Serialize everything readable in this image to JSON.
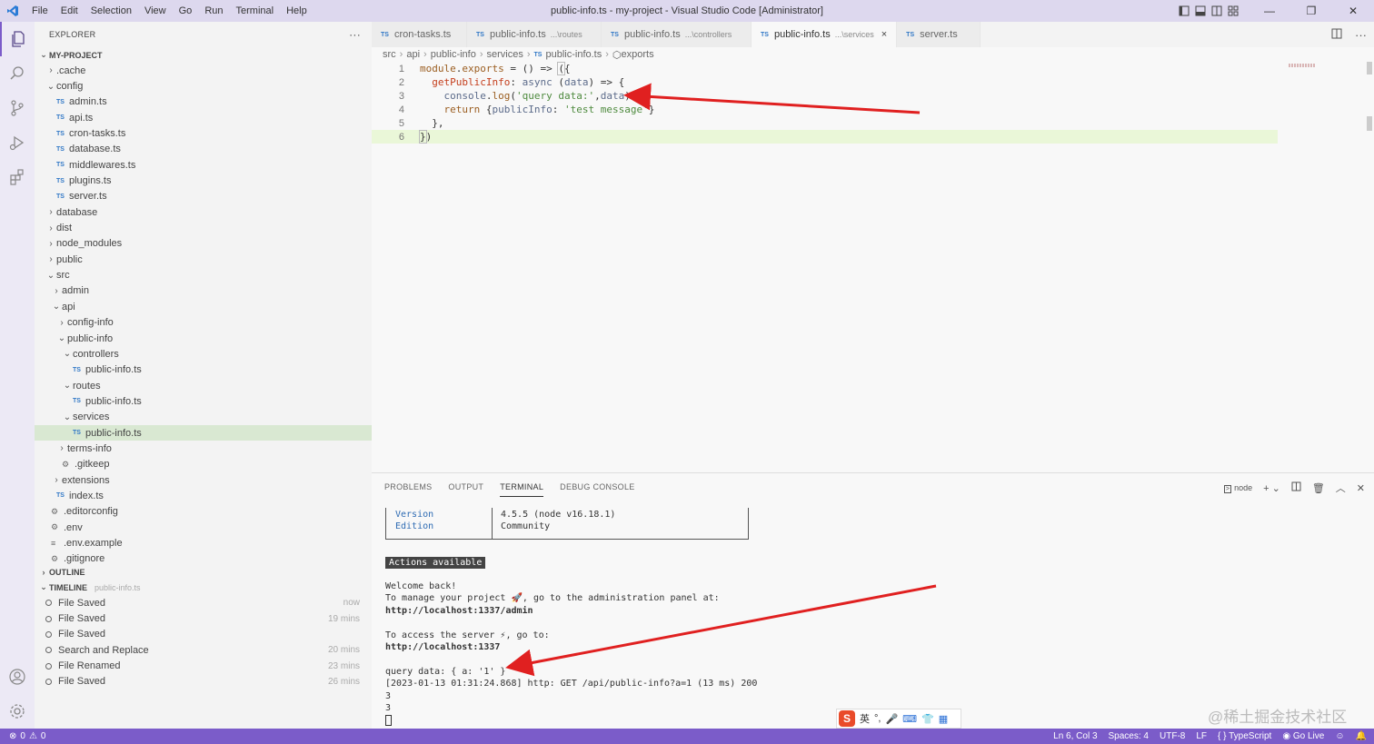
{
  "titlebar": {
    "menu": [
      "File",
      "Edit",
      "Selection",
      "View",
      "Go",
      "Run",
      "Terminal",
      "Help"
    ],
    "window_title": "public-info.ts - my-project - Visual Studio Code [Administrator]"
  },
  "sidebar": {
    "explorer_label": "EXPLORER",
    "more": "···",
    "project": "MY-PROJECT",
    "tree": [
      {
        "label": ".cache",
        "type": "folder",
        "open": false,
        "depth": 0
      },
      {
        "label": "config",
        "type": "folder",
        "open": true,
        "depth": 0
      },
      {
        "label": "admin.ts",
        "type": "ts",
        "depth": 1
      },
      {
        "label": "api.ts",
        "type": "ts",
        "depth": 1
      },
      {
        "label": "cron-tasks.ts",
        "type": "ts",
        "depth": 1
      },
      {
        "label": "database.ts",
        "type": "ts",
        "depth": 1
      },
      {
        "label": "middlewares.ts",
        "type": "ts",
        "depth": 1
      },
      {
        "label": "plugins.ts",
        "type": "ts",
        "depth": 1
      },
      {
        "label": "server.ts",
        "type": "ts",
        "depth": 1
      },
      {
        "label": "database",
        "type": "folder",
        "open": false,
        "depth": 0
      },
      {
        "label": "dist",
        "type": "folder",
        "open": false,
        "depth": 0
      },
      {
        "label": "node_modules",
        "type": "folder",
        "open": false,
        "depth": 0
      },
      {
        "label": "public",
        "type": "folder",
        "open": false,
        "depth": 0
      },
      {
        "label": "src",
        "type": "folder",
        "open": true,
        "depth": 0
      },
      {
        "label": "admin",
        "type": "folder",
        "open": false,
        "depth": 1
      },
      {
        "label": "api",
        "type": "folder",
        "open": true,
        "depth": 1
      },
      {
        "label": "config-info",
        "type": "folder",
        "open": false,
        "depth": 2
      },
      {
        "label": "public-info",
        "type": "folder",
        "open": true,
        "depth": 2
      },
      {
        "label": "controllers",
        "type": "folder",
        "open": true,
        "depth": 3
      },
      {
        "label": "public-info.ts",
        "type": "ts",
        "depth": 4
      },
      {
        "label": "routes",
        "type": "folder",
        "open": true,
        "depth": 3
      },
      {
        "label": "public-info.ts",
        "type": "ts",
        "depth": 4
      },
      {
        "label": "services",
        "type": "folder",
        "open": true,
        "depth": 3
      },
      {
        "label": "public-info.ts",
        "type": "ts",
        "depth": 4,
        "selected": true
      },
      {
        "label": "terms-info",
        "type": "folder",
        "open": false,
        "depth": 2
      },
      {
        "label": ".gitkeep",
        "type": "config",
        "depth": 2
      },
      {
        "label": "extensions",
        "type": "folder",
        "open": false,
        "depth": 1
      },
      {
        "label": "index.ts",
        "type": "ts",
        "depth": 1
      },
      {
        "label": ".editorconfig",
        "type": "config",
        "depth": 0
      },
      {
        "label": ".env",
        "type": "config",
        "depth": 0
      },
      {
        "label": ".env.example",
        "type": "plain",
        "depth": 0
      },
      {
        "label": ".gitignore",
        "type": "config",
        "depth": 0
      }
    ],
    "outline_label": "OUTLINE",
    "timeline_label": "TIMELINE",
    "timeline_file": "public-info.ts",
    "timeline": [
      {
        "label": "File Saved",
        "time": "now"
      },
      {
        "label": "File Saved",
        "time": "19 mins"
      },
      {
        "label": "File Saved",
        "time": ""
      },
      {
        "label": "Search and Replace",
        "time": "20 mins"
      },
      {
        "label": "File Renamed",
        "time": "23 mins"
      },
      {
        "label": "File Saved",
        "time": "26 mins"
      }
    ]
  },
  "tabs": [
    {
      "label": "cron-tasks.ts",
      "desc": ""
    },
    {
      "label": "public-info.ts",
      "desc": "...\\routes"
    },
    {
      "label": "public-info.ts",
      "desc": "...\\controllers"
    },
    {
      "label": "public-info.ts",
      "desc": "...\\services",
      "active": true
    },
    {
      "label": "server.ts",
      "desc": ""
    }
  ],
  "tab_ts": "TS",
  "tab_close": "×",
  "breadcrumb": [
    "src",
    "api",
    "public-info",
    "services",
    "public-info.ts",
    "exports"
  ],
  "editor": {
    "line_numbers": [
      "1",
      "2",
      "3",
      "4",
      "5",
      "6"
    ]
  },
  "panel": {
    "tabs": [
      "PROBLEMS",
      "OUTPUT",
      "TERMINAL",
      "DEBUG CONSOLE"
    ],
    "shell": "node",
    "table": {
      "k1": "Version",
      "v1": "4.5.5 (node v16.18.1)",
      "k2": "Edition",
      "v2": "Community"
    },
    "badge": "Actions available",
    "lines": [
      "Welcome back!",
      "To manage your project 🚀, go to the administration panel at:",
      "http://localhost:1337/admin",
      "",
      "To access the server ⚡, go to:",
      "http://localhost:1337",
      "",
      "query data: { a: '1' }",
      "[2023-01-13 01:31:24.868] http: GET /api/public-info?a=1 (13 ms) 200",
      "3",
      "3"
    ]
  },
  "ime": {
    "s": "S",
    "lang": "英"
  },
  "watermark": "@稀土掘金技术社区",
  "statusbar": {
    "errors": "0",
    "warnings": "0",
    "position": "Ln 6, Col 3",
    "spaces": "Spaces: 4",
    "encoding": "UTF-8",
    "eol": "LF",
    "language": "TypeScript",
    "golive": "Go Live"
  },
  "colors": {
    "accent": "#7b5cc9",
    "arrow": "#e02020",
    "selected_row": "#d9e8d2"
  }
}
